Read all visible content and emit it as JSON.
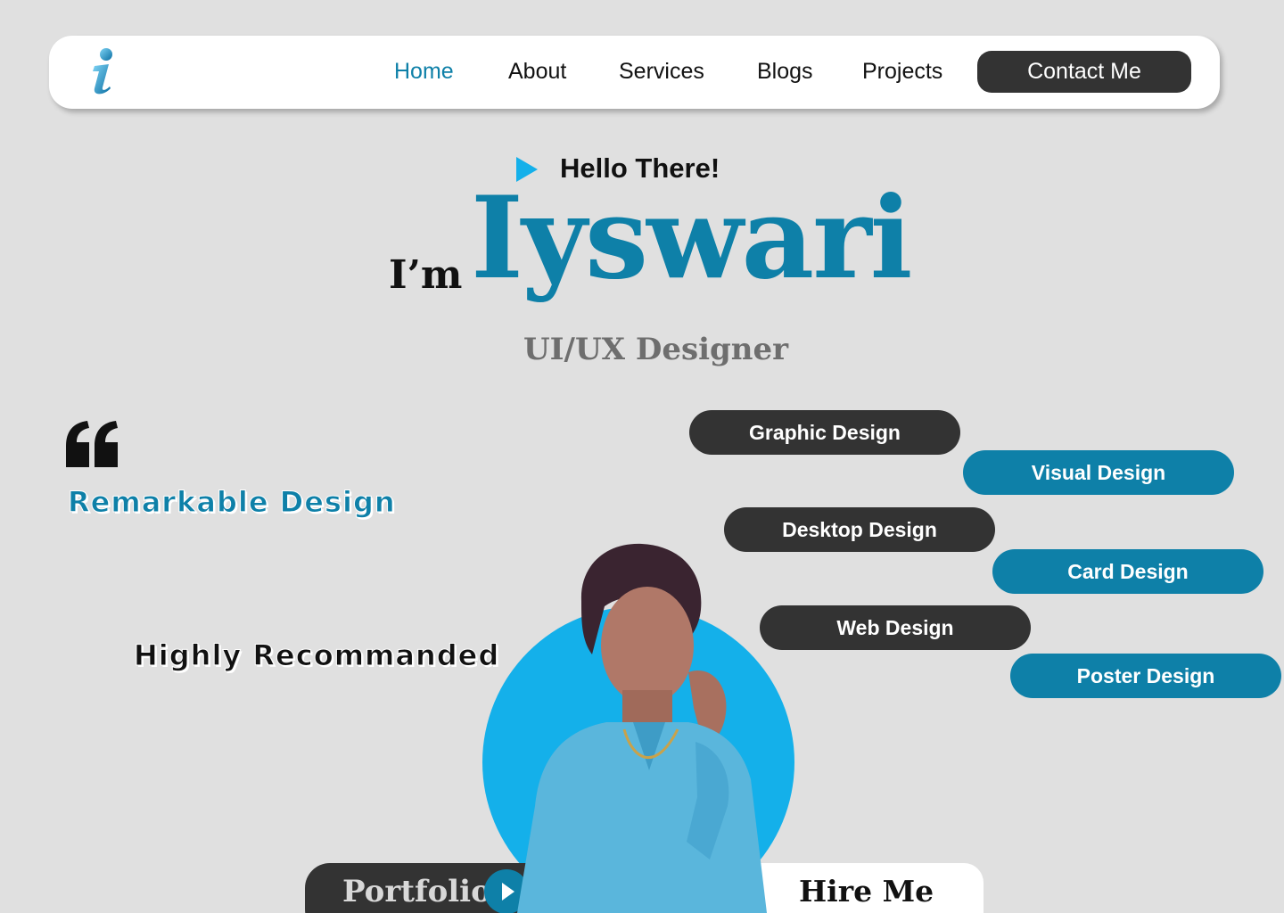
{
  "nav": {
    "logo_icon": "info-i-logo",
    "items": [
      {
        "label": "Home",
        "active": true
      },
      {
        "label": "About",
        "active": false
      },
      {
        "label": "Services",
        "active": false
      },
      {
        "label": "Blogs",
        "active": false
      },
      {
        "label": "Projects",
        "active": false
      }
    ],
    "contact_label": "Contact Me"
  },
  "hero": {
    "greeting_icon": "play-triangle-icon",
    "greeting": "Hello There!",
    "prefix": "I’m",
    "name": "Iyswari",
    "role": "UI/UX Designer"
  },
  "left": {
    "quote_icon": "quote-icon",
    "remark": "Remarkable Design",
    "recommend": "Highly Recommanded"
  },
  "tags": [
    {
      "label": "Graphic Design",
      "style": "dark"
    },
    {
      "label": "Visual Design",
      "style": "blue"
    },
    {
      "label": "Desktop Design",
      "style": "dark"
    },
    {
      "label": "Card Design",
      "style": "blue"
    },
    {
      "label": "Web Design",
      "style": "dark"
    },
    {
      "label": "Poster Design",
      "style": "blue"
    }
  ],
  "cta": {
    "portfolio": "Portfolio",
    "portfolio_icon": "play-icon",
    "hire": "Hire Me"
  },
  "colors": {
    "accent": "#0e80a8",
    "accent_light": "#14b0ea",
    "dark": "#333333",
    "background": "#e0e0e0"
  }
}
